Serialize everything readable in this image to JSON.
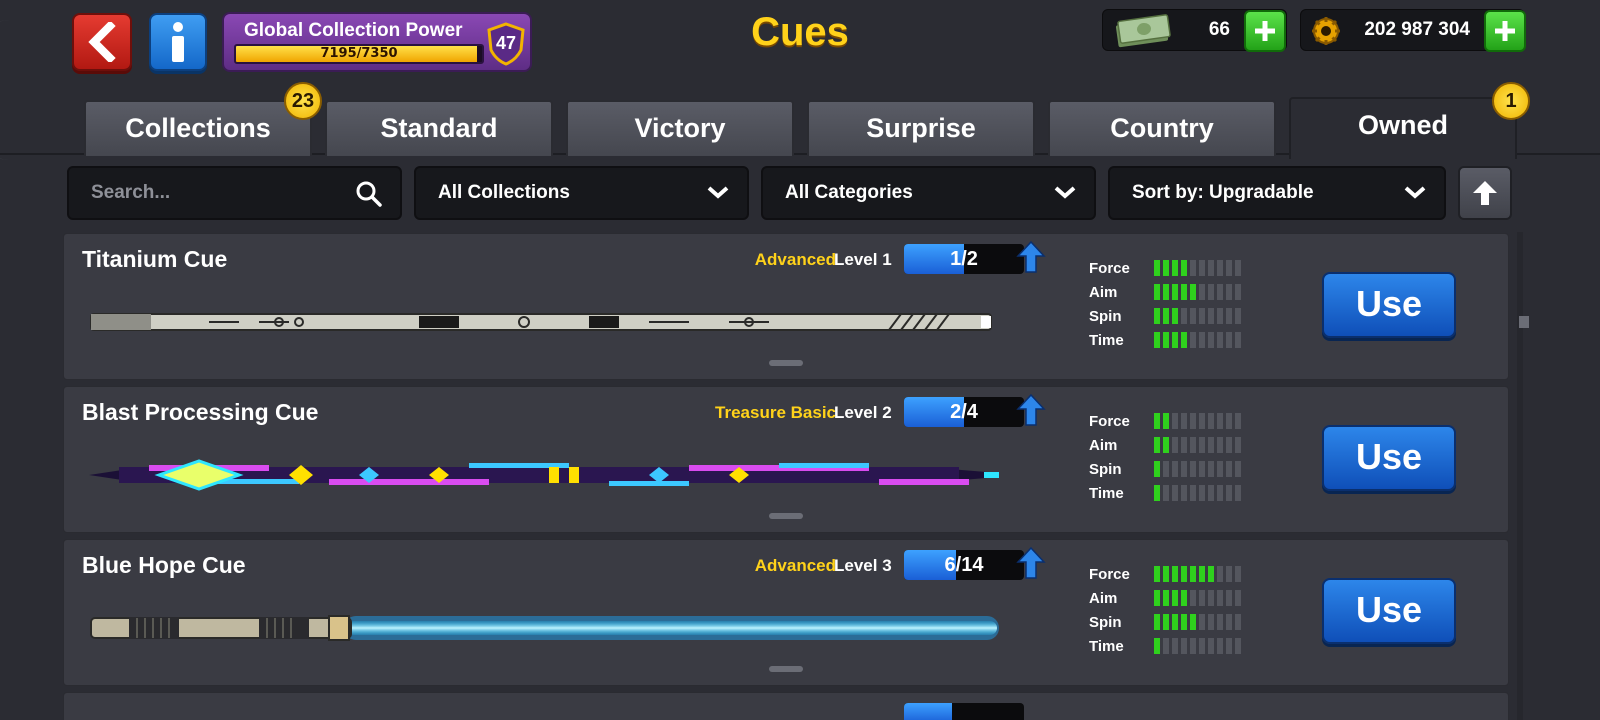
{
  "header": {
    "title": "Cues",
    "collection_power": {
      "label": "Global Collection Power",
      "progress_text": "7195/7350",
      "current": 7195,
      "total": 7350,
      "level": "47"
    },
    "cash": {
      "value": "66"
    },
    "coins": {
      "value": "202 987 304"
    }
  },
  "tabs": [
    {
      "label": "Collections",
      "badge": "23"
    },
    {
      "label": "Standard"
    },
    {
      "label": "Victory"
    },
    {
      "label": "Surprise"
    },
    {
      "label": "Country"
    },
    {
      "label": "Owned",
      "badge": "1",
      "active": true
    }
  ],
  "filters": {
    "search_placeholder": "Search...",
    "collection": "All Collections",
    "category": "All Categories",
    "sort": "Sort by: Upgradable"
  },
  "stat_labels": {
    "force": "Force",
    "aim": "Aim",
    "spin": "Spin",
    "time": "Time"
  },
  "use_label": "Use",
  "cues": [
    {
      "name": "Titanium Cue",
      "tier": "Advanced",
      "level": "Level 1",
      "progress_text": "1/2",
      "progress": 0.5,
      "stats": {
        "force": 4,
        "aim": 5,
        "spin": 3,
        "time": 4
      }
    },
    {
      "name": "Blast Processing Cue",
      "tier": "Treasure Basic",
      "level": "Level 2",
      "progress_text": "2/4",
      "progress": 0.5,
      "stats": {
        "force": 2,
        "aim": 2,
        "spin": 1,
        "time": 1
      }
    },
    {
      "name": "Blue Hope Cue",
      "tier": "Advanced",
      "level": "Level 3",
      "progress_text": "6/14",
      "progress": 0.43,
      "stats": {
        "force": 7,
        "aim": 4,
        "spin": 5,
        "time": 1
      }
    }
  ],
  "colors": {
    "accent_yellow": "#ffd21a",
    "stat_green": "#2fd11d",
    "use_blue": "#1a6ad8",
    "back_red": "#d12a20"
  }
}
